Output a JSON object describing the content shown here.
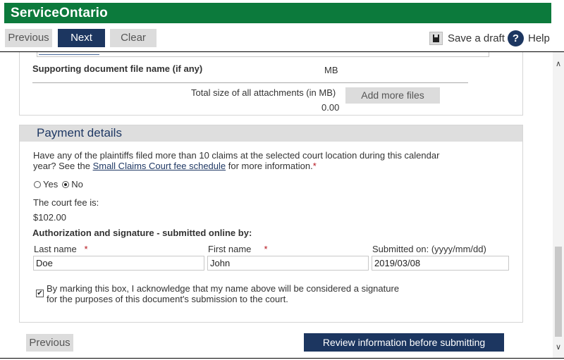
{
  "header": {
    "brand": "ServiceOntario"
  },
  "toolbar": {
    "previous_label": "Previous",
    "next_label": "Next",
    "clear_label": "Clear",
    "save_draft_label": "Save a draft",
    "help_label": "Help",
    "help_icon_glyph": "?"
  },
  "attachments": {
    "doc_name_label": "Supporting document file name (if any)",
    "mb_label": "MB",
    "total_label": "Total size of all attachments (in MB)",
    "total_value": "0.00",
    "add_files_label": "Add more files"
  },
  "payment": {
    "title": "Payment details",
    "question_line1": "Have any of the plaintiffs filed more than 10 claims at the selected court location during this calendar",
    "question_prefix": "year? See the ",
    "question_link": "Small Claims Court fee schedule",
    "question_suffix": " for more information.",
    "required_mark": "*",
    "radio_yes": "Yes",
    "radio_no": "No",
    "selected": "No",
    "fee_label": "The court fee is:",
    "fee_value": "$102.00"
  },
  "signature": {
    "title": "Authorization and signature - submitted online by:",
    "last_name_label": "Last name",
    "last_name_value": "Doe",
    "first_name_label": "First name",
    "first_name_value": "John",
    "submitted_label": "Submitted on: (yyyy/mm/dd)",
    "submitted_value": "2019/03/08",
    "required_mark": "*",
    "ack_checked": true,
    "ack_text_line1": "By marking this box, I acknowledge that my name above will be considered a signature",
    "ack_text_line2": "for the purposes of this document's submission to the court."
  },
  "footer": {
    "previous_label": "Previous",
    "review_label": "Review information before submitting"
  },
  "icons": {
    "save": "floppy-disk-icon",
    "help": "help-icon",
    "scroll_up": "chevron-up-icon",
    "scroll_down": "chevron-down-icon",
    "checkbox": "checkmark-icon"
  },
  "colors": {
    "brand_green": "#0c7a3c",
    "navy": "#1c3660",
    "heading_blue": "#1f3864",
    "required_red": "#b5121b"
  }
}
